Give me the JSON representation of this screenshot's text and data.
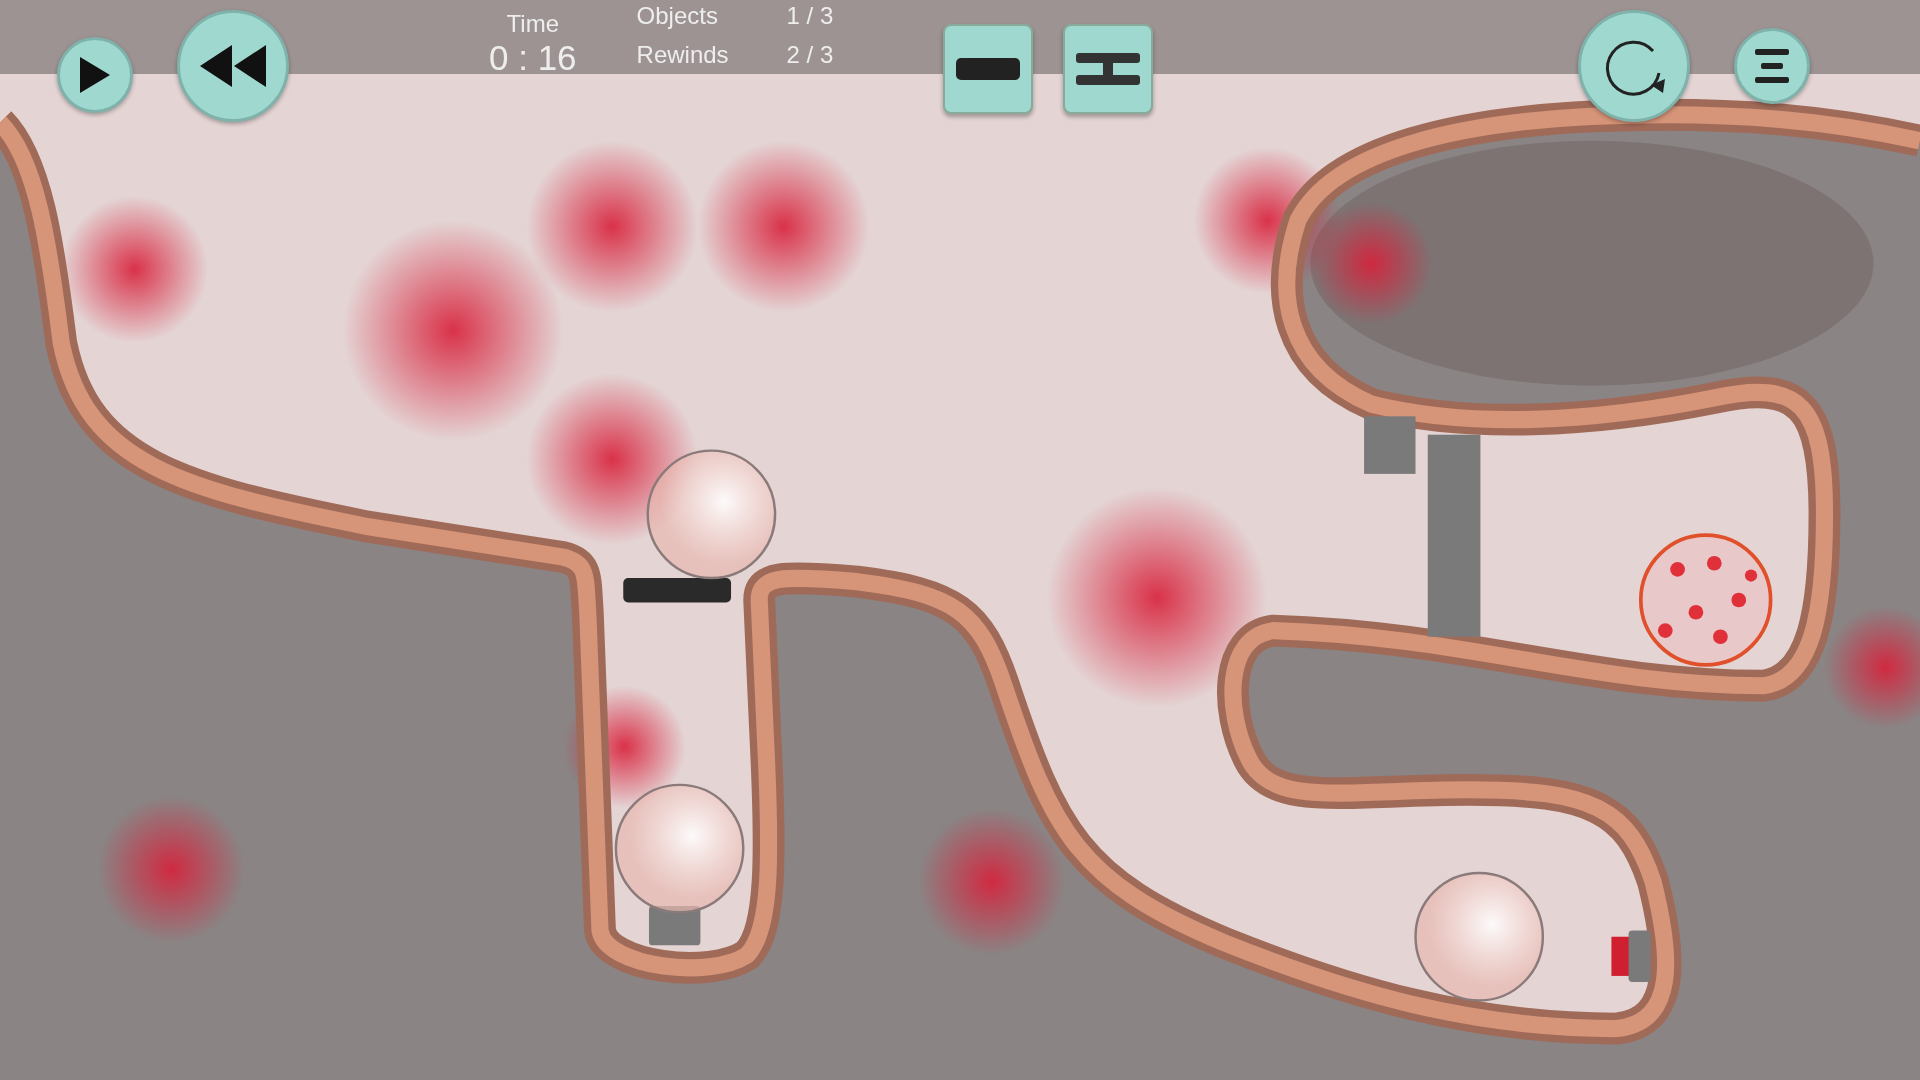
{
  "controls": [
    {
      "kind": "play"
    },
    {
      "kind": "rewind"
    }
  ],
  "timer": {
    "label": "Time",
    "value": "0 : 16"
  },
  "stats": [
    {
      "label": "Objects",
      "value": "1 / 3"
    },
    {
      "label": "Rewinds",
      "value": "2 / 3"
    }
  ],
  "tools": [
    {
      "kind": "bar"
    },
    {
      "kind": "double-bar"
    }
  ],
  "actions": [
    {
      "kind": "restart"
    },
    {
      "kind": "menu"
    }
  ]
}
